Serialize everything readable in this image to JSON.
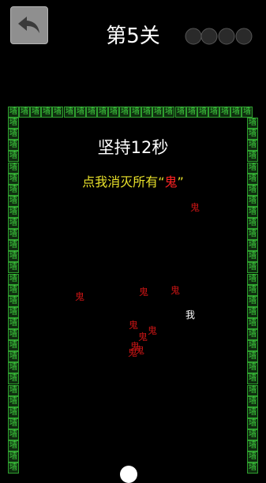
{
  "header": {
    "back_icon": "undo-arrow-icon",
    "level_title": "第5关"
  },
  "game": {
    "wall_char": "墙",
    "timer_text": "坚持12秒",
    "instruction_prefix": "点我消灭所有",
    "instruction_open_quote": "“",
    "instruction_target": "鬼",
    "instruction_close_quote": "”",
    "ghost_char": "鬼",
    "player_char": "我"
  },
  "colors": {
    "wall_text": "#3fd13f",
    "wall_border": "#2f9e2f",
    "ghost": "#c51414",
    "instruction": "#e8e02a",
    "background": "#000000"
  }
}
